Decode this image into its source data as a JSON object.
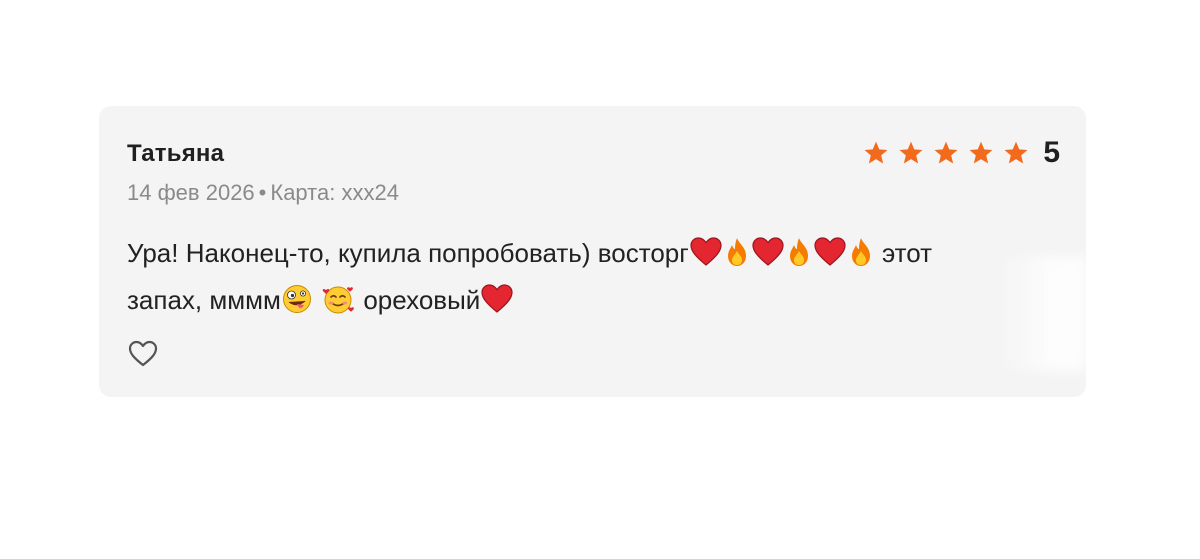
{
  "review": {
    "author": "Татьяна",
    "date": "14 фев 2026",
    "separator": "•",
    "card_label": "Карта: xxx24",
    "rating": {
      "value": "5",
      "stars_filled": 5,
      "stars_total": 5,
      "star_color": "#f26b1d"
    },
    "text_parts": {
      "p1": "Ура! Наконец-то, купила попробовать) восторг",
      "p2": " этот",
      "p3": "запах, мммм",
      "p4": " ",
      "p5": " ореховый"
    },
    "emojis": [
      "heart-emoji",
      "fire-emoji",
      "heart-emoji",
      "fire-emoji",
      "heart-emoji",
      "fire-emoji",
      "zany-face-emoji",
      "smiling-face-with-hearts-emoji",
      "heart-emoji"
    ]
  },
  "like": {
    "icon": "heart-outline-icon"
  }
}
